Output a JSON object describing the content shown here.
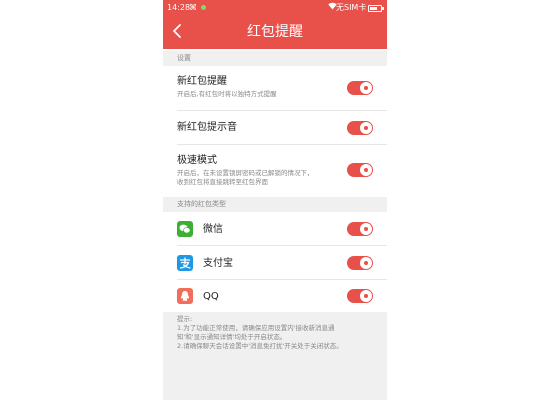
{
  "status_bar": {
    "time": "14:28",
    "carrier": "无SIM卡"
  },
  "header": {
    "title": "红包提醒",
    "accent_color": "#e8504a"
  },
  "sections": {
    "settings": "设置",
    "supported_types": "支持的红包类型"
  },
  "settings": [
    {
      "title": "新红包提醒",
      "subtitle": "开启后,有红包时将以独特方式提醒",
      "enabled": true
    },
    {
      "title": "新红包提示音",
      "subtitle": "",
      "enabled": true
    },
    {
      "title": "极速模式",
      "subtitle_line1": "开启后，在未设置锁屏密码或已解锁的情况下，",
      "subtitle_line2": "收到红包将直接跳转至红包界面",
      "enabled": true
    }
  ],
  "apps": [
    {
      "name": "微信",
      "icon": "wechat-icon",
      "color": "#3cb034",
      "enabled": true
    },
    {
      "name": "支付宝",
      "icon": "alipay-icon",
      "color": "#1e98e6",
      "enabled": true
    },
    {
      "name": "QQ",
      "icon": "qq-icon",
      "color": "#f06e5a",
      "enabled": true
    }
  ],
  "tips": {
    "heading": "提示:",
    "line1": "1.为了功能正常使用，请确保应用设置内'接收新消息通",
    "line2": "知'和'显示通知详情'均处于开启状态。",
    "line3": "2.请确保聊天会话设置中'消息免打扰'开关处于关闭状态。"
  }
}
